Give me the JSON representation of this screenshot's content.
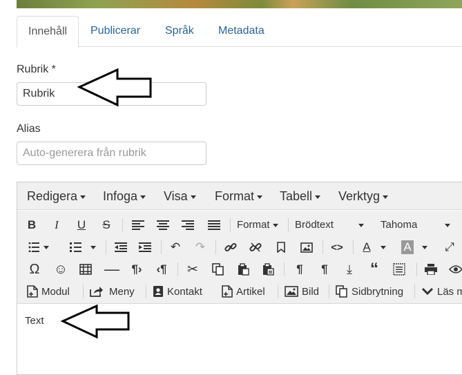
{
  "tabs": [
    "Innehåll",
    "Publicerar",
    "Språk",
    "Metadata"
  ],
  "title_field": {
    "label": "Rubrik *",
    "value": "Rubrik"
  },
  "alias_field": {
    "label": "Alias",
    "placeholder": "Auto-generera från rubrik"
  },
  "menubar": [
    "Redigera",
    "Infoga",
    "Visa",
    "Format",
    "Tabell",
    "Verktyg"
  ],
  "toolbar": {
    "format_select": "Format",
    "block_select": "Brödtext",
    "font_select": "Tahoma",
    "text_color_glyph": "A",
    "bg_color_glyph": "A"
  },
  "extension_buttons": [
    "Modul",
    "Meny",
    "Kontakt",
    "Artikel",
    "Bild",
    "Sidbrytning",
    "Läs mer"
  ],
  "editor_text": "Text",
  "colors": {
    "link": "#2a6496",
    "toolbar_bg": "#f0f0f0",
    "border": "#cccccc"
  }
}
